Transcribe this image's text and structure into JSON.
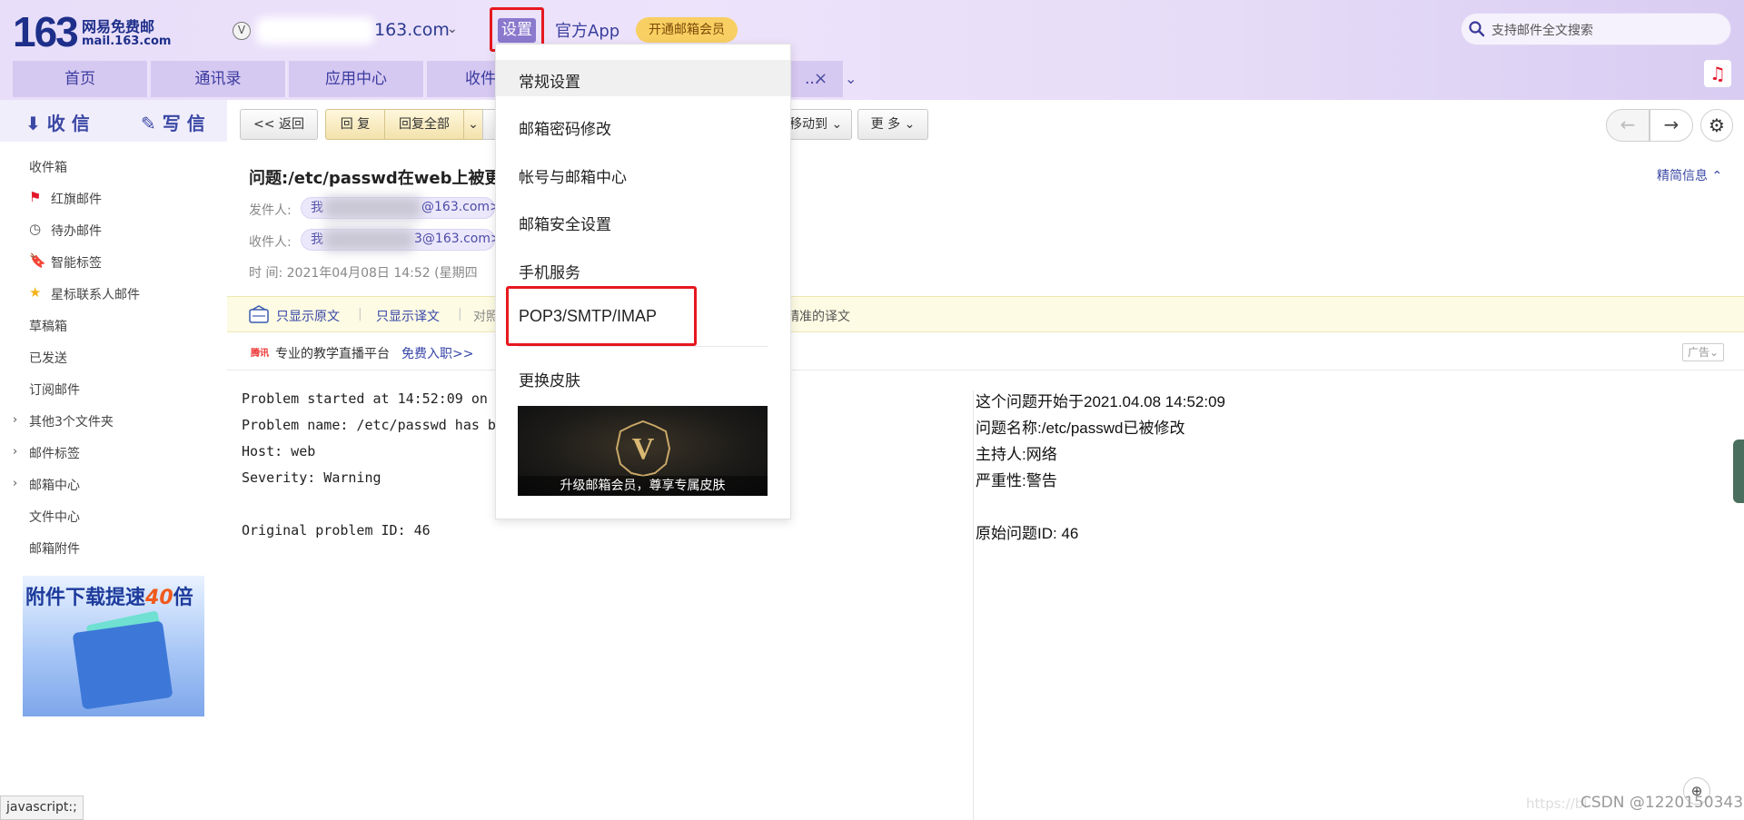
{
  "header": {
    "logo_number": "163",
    "logo_line1": "网易免费邮",
    "logo_line2": "mail.163.com",
    "vip_badge": "V",
    "account_domain": "163.com",
    "settings_label": "设置",
    "app_link": "官方App",
    "vip_button": "开通邮箱会员",
    "search_placeholder": "支持邮件全文搜索"
  },
  "tabs": [
    {
      "label": "首页"
    },
    {
      "label": "通讯录"
    },
    {
      "label": "应用中心"
    },
    {
      "label": "收件"
    },
    {
      "label": "..."
    }
  ],
  "tab_close": "×",
  "tab_more": "⌄",
  "sidebar": {
    "receive": "收 信",
    "write": "写 信",
    "items": [
      {
        "label": "收件箱"
      },
      {
        "label": "红旗邮件"
      },
      {
        "label": "待办邮件"
      },
      {
        "label": "智能标签"
      },
      {
        "label": "星标联系人邮件"
      },
      {
        "label": "草稿箱"
      },
      {
        "label": "已发送"
      },
      {
        "label": "订阅邮件"
      },
      {
        "label": "其他3个文件夹"
      },
      {
        "label": "邮件标签"
      },
      {
        "label": "邮箱中心"
      },
      {
        "label": "文件中心"
      },
      {
        "label": "邮箱附件"
      }
    ],
    "ad_title_prefix": "附件下载提速",
    "ad_title_number": "40",
    "ad_title_suffix": "倍"
  },
  "toolbar": {
    "back": "<< 返回",
    "reply": "回 复",
    "reply_all": "回复全部",
    "move_to": "移动到",
    "more": "更 多"
  },
  "mail": {
    "subject": "问题:/etc/passwd在web上被更",
    "detail_link": "精简信息",
    "from_label": "发件人:",
    "from_prefix": "我",
    "from_suffix": "@163.com>",
    "to_label": "收件人:",
    "to_prefix": "我",
    "to_suffix": "3@163.com>",
    "time_label": "时    间:",
    "time_value": "2021年04月08日 14:52 (星期四"
  },
  "translation_bar": {
    "show_original": "只显示原文",
    "show_translation": "只显示译文",
    "compare": "对照",
    "tail": "精准的译文"
  },
  "ad_strip": {
    "logo": "腾讯",
    "text": "专业的教学直播平台",
    "cta": "免费入职>>",
    "tag": "广告"
  },
  "body_original": [
    "Problem started at 14:52:09 on",
    "Problem name: /etc/passwd has b",
    "Host: web",
    "Severity: Warning",
    "",
    "Original problem ID: 46"
  ],
  "body_translated": [
    "这个问题开始于2021.04.08 14:52:09",
    "问题名称:/etc/passwd已被修改",
    "主持人:网络",
    "严重性:警告",
    "",
    "原始问题ID: 46"
  ],
  "dropdown": {
    "items": [
      {
        "label": "常规设置"
      },
      {
        "label": "邮箱密码修改"
      },
      {
        "label": "帐号与邮箱中心"
      },
      {
        "label": "邮箱安全设置"
      },
      {
        "label": "手机服务"
      },
      {
        "label": "POP3/SMTP/IMAP"
      },
      {
        "label": "更换皮肤"
      }
    ],
    "banner_caption": "升级邮箱会员，尊享专属皮肤",
    "banner_letter": "V"
  },
  "status_bar": "javascript:;",
  "watermark": "CSDN @1220150343",
  "watermark_faint": "https://bl",
  "colors": {
    "header_bg": "#e8def9",
    "tab_bg": "#d6c9f1",
    "settings_active": "#8a79cd",
    "highlight_red": "#e6181f",
    "vip_gold": "#f8cf62",
    "link_blue": "#3645a8"
  }
}
